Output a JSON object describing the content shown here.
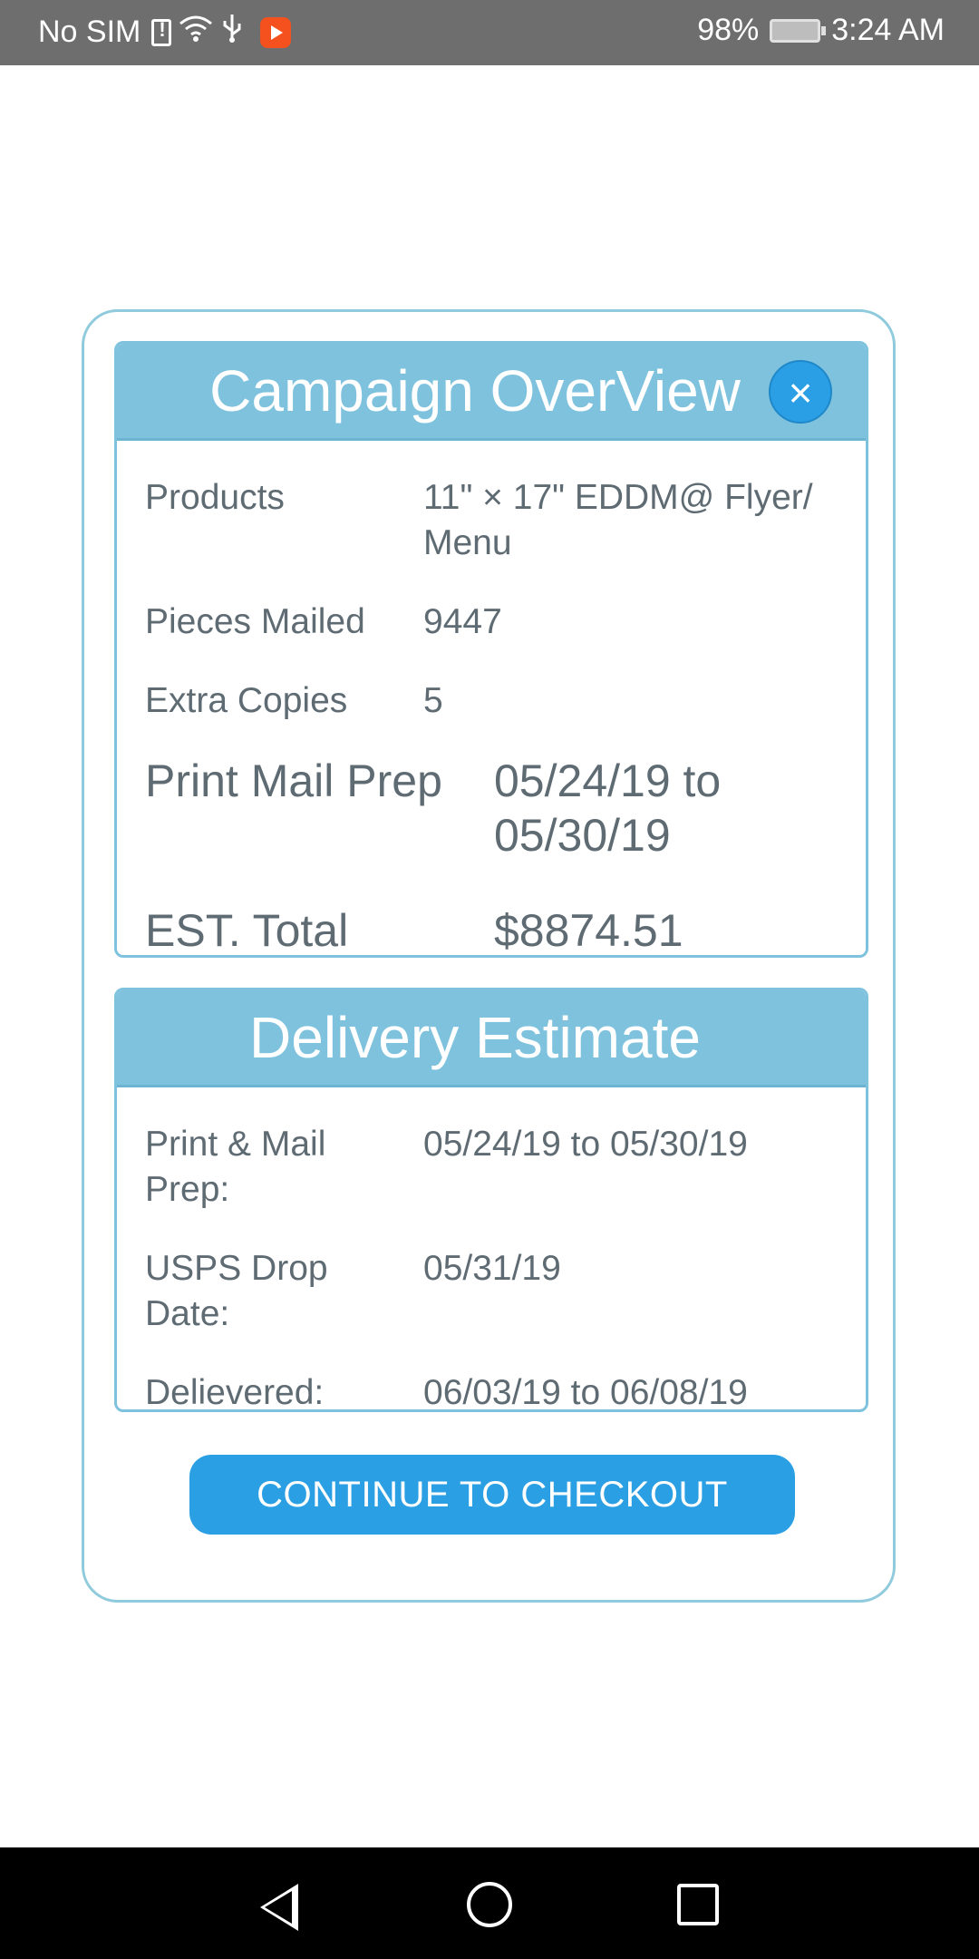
{
  "status_bar": {
    "carrier": "No SIM",
    "battery": "98%",
    "time": "3:24 AM"
  },
  "overview": {
    "title": "Campaign OverView",
    "close_glyph": "×",
    "rows": [
      {
        "label": "Products",
        "value": "11\" × 17\" EDDM@ Flyer/ Menu"
      },
      {
        "label": "Pieces Mailed",
        "value": "9447"
      },
      {
        "label": "Extra Copies",
        "value": "5"
      },
      {
        "label": "Print Mail Prep",
        "value": "05/24/19 to 05/30/19"
      },
      {
        "label": "EST. Total",
        "value": "$8874.51"
      }
    ]
  },
  "delivery": {
    "title": "Delivery Estimate",
    "rows": [
      {
        "label": "Print & Mail Prep:",
        "value": "05/24/19 to 05/30/19"
      },
      {
        "label": "USPS Drop Date:",
        "value": "05/31/19"
      },
      {
        "label": "Delievered:",
        "value": "06/03/19 to 06/08/19"
      }
    ]
  },
  "checkout_label": "CONTINUE TO CHECKOUT",
  "colors": {
    "header_blue": "#7fc2de",
    "button_blue": "#2b9fe3",
    "text_gray": "#5f6b73"
  }
}
